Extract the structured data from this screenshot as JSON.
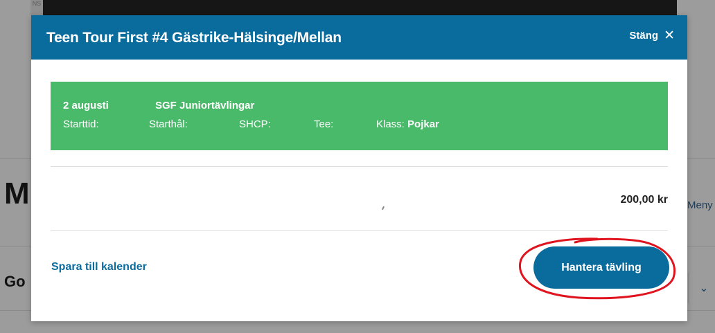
{
  "background": {
    "banner_edge_text": "NS",
    "heading_fragment": "M",
    "subheading_fragment": "Go",
    "menu_fragment": "Meny",
    "select_chevron_icon": "chevron-down-icon"
  },
  "modal": {
    "title": "Teen Tour First #4 Gästrike-Hälsinge/Mellan",
    "close_label": "Stäng",
    "close_icon": "close-icon",
    "info": {
      "date": "2 augusti",
      "organizer": "SGF Juniortävlingar",
      "start_time_label": "Starttid:",
      "start_hole_label": "Starthål:",
      "shcp_label": "SHCP:",
      "tee_label": "Tee:",
      "class_label": "Klass:",
      "class_value": "Pojkar"
    },
    "price": "200,00 kr",
    "save_calendar_label": "Spara till kalender",
    "manage_button_label": "Hantera tävling"
  },
  "colors": {
    "header_blue": "#0a6b9d",
    "info_green": "#49b96a",
    "highlight_red": "#e0141e"
  }
}
